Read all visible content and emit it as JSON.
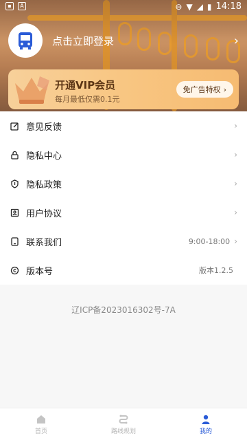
{
  "status_bar": {
    "time": "14:18",
    "left_icons": [
      "image-icon",
      "a-icon"
    ]
  },
  "profile": {
    "login_text": "点击立即登录"
  },
  "vip": {
    "title": "开通VIP会员",
    "subtitle": "每月最低仅需0.1元",
    "button_label": "免广告特权"
  },
  "menu": {
    "items": [
      {
        "label": "意见反馈",
        "icon": "feedback-icon",
        "value": ""
      },
      {
        "label": "隐私中心",
        "icon": "lock-icon",
        "value": ""
      },
      {
        "label": "隐私政策",
        "icon": "shield-icon",
        "value": ""
      },
      {
        "label": "用户协议",
        "icon": "user-agreement-icon",
        "value": ""
      },
      {
        "label": "联系我们",
        "icon": "phone-icon",
        "value": "9:00-18:00"
      },
      {
        "label": "版本号",
        "icon": "copyright-icon",
        "value": "版本1.2.5"
      }
    ]
  },
  "icp": "辽ICP备2023016302号-7A",
  "tabs": [
    {
      "label": "首页",
      "icon": "home-icon",
      "active": false
    },
    {
      "label": "路线规划",
      "icon": "route-icon",
      "active": false
    },
    {
      "label": "我的",
      "icon": "person-icon",
      "active": true
    }
  ],
  "colors": {
    "accent": "#2a5bd7",
    "vip_gold": "#f8c682"
  }
}
